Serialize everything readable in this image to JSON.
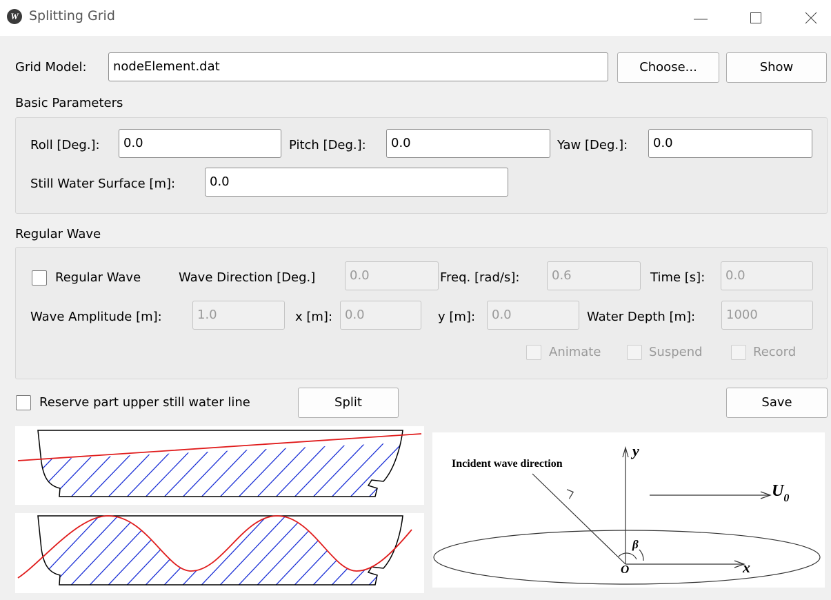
{
  "window": {
    "title": "Splitting Grid",
    "icon_letter": "W"
  },
  "grid_model": {
    "label": "Grid Model:",
    "value": "nodeElement.dat",
    "choose_label": "Choose...",
    "show_label": "Show"
  },
  "basic": {
    "title": "Basic Parameters",
    "roll_label": "Roll [Deg.]:",
    "roll_value": "0.0",
    "pitch_label": "Pitch [Deg.]:",
    "pitch_value": "0.0",
    "yaw_label": "Yaw [Deg.]:",
    "yaw_value": "0.0",
    "swl_label": "Still Water Surface [m]:",
    "swl_value": "0.0"
  },
  "wave": {
    "title": "Regular Wave",
    "enable_label": "Regular Wave",
    "enable_checked": false,
    "direction_label": "Wave Direction [Deg.]",
    "direction_value": "0.0",
    "freq_label": "Freq. [rad/s]:",
    "freq_value": "0.6",
    "time_label": "Time [s]:",
    "time_value": "0.0",
    "amplitude_label": "Wave Amplitude [m]:",
    "amplitude_value": "1.0",
    "x_label": "x [m]:",
    "x_value": "0.0",
    "y_label": "y [m]:",
    "y_value": "0.0",
    "depth_label": "Water Depth [m]:",
    "depth_value": "1000",
    "animate_label": "Animate",
    "suspend_label": "Suspend",
    "record_label": "Record"
  },
  "actions": {
    "reserve_label": "Reserve part upper still water line",
    "reserve_checked": false,
    "split_label": "Split",
    "save_label": "Save"
  },
  "diagram": {
    "incident_label": "Incident wave direction",
    "y_axis": "y",
    "x_axis": "x",
    "velocity": "U",
    "velocity_sub": "0",
    "angle": "β",
    "origin": "O"
  },
  "colors": {
    "hatch": "#1a2fd6",
    "waterline": "#e01b1b",
    "hull": "#000000"
  }
}
